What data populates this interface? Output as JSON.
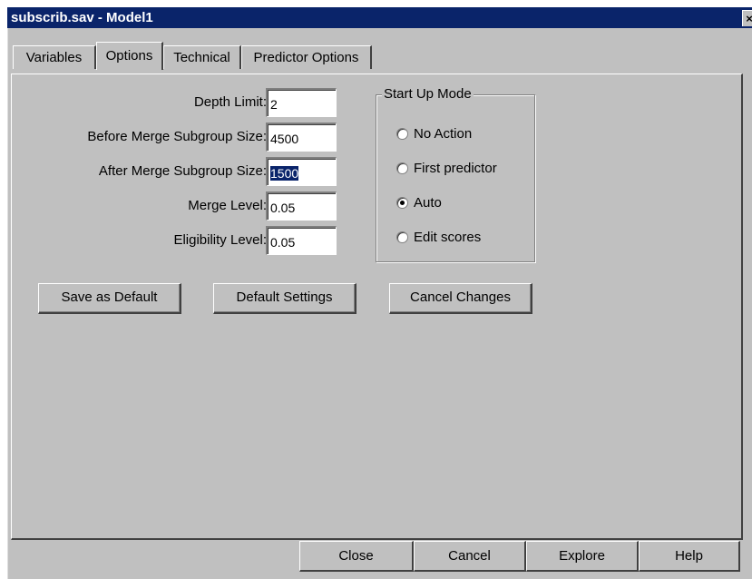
{
  "window": {
    "title": "subscrib.sav - Model1",
    "close_glyph": "×"
  },
  "tabs": [
    {
      "label": "Variables",
      "active": false
    },
    {
      "label": "Options",
      "active": true
    },
    {
      "label": "Technical",
      "active": false
    },
    {
      "label": "Predictor Options",
      "active": false
    }
  ],
  "options": {
    "fields": [
      {
        "label": "Depth Limit:",
        "value": "2"
      },
      {
        "label": "Before Merge Subgroup Size:",
        "value": "4500"
      },
      {
        "label": "After Merge Subgroup Size:",
        "value": "1500"
      },
      {
        "label": "Merge Level:",
        "value": "0.05"
      },
      {
        "label": "Eligibility Level:",
        "value": "0.05"
      }
    ],
    "startup": {
      "legend": "Start Up Mode",
      "options": [
        {
          "label": "No Action",
          "checked": false
        },
        {
          "label": "First predictor",
          "checked": false
        },
        {
          "label": "Auto",
          "checked": true
        },
        {
          "label": "Edit scores",
          "checked": false
        }
      ]
    },
    "buttons": {
      "save_default": "Save as Default",
      "default_settings": "Default Settings",
      "cancel_changes": "Cancel Changes"
    }
  },
  "footer": {
    "close": "Close",
    "cancel": "Cancel",
    "explore": "Explore",
    "help": "Help"
  },
  "colors": {
    "titlebar": "#0a246a",
    "face": "#c0c0c0",
    "selection": "#0a246a"
  }
}
